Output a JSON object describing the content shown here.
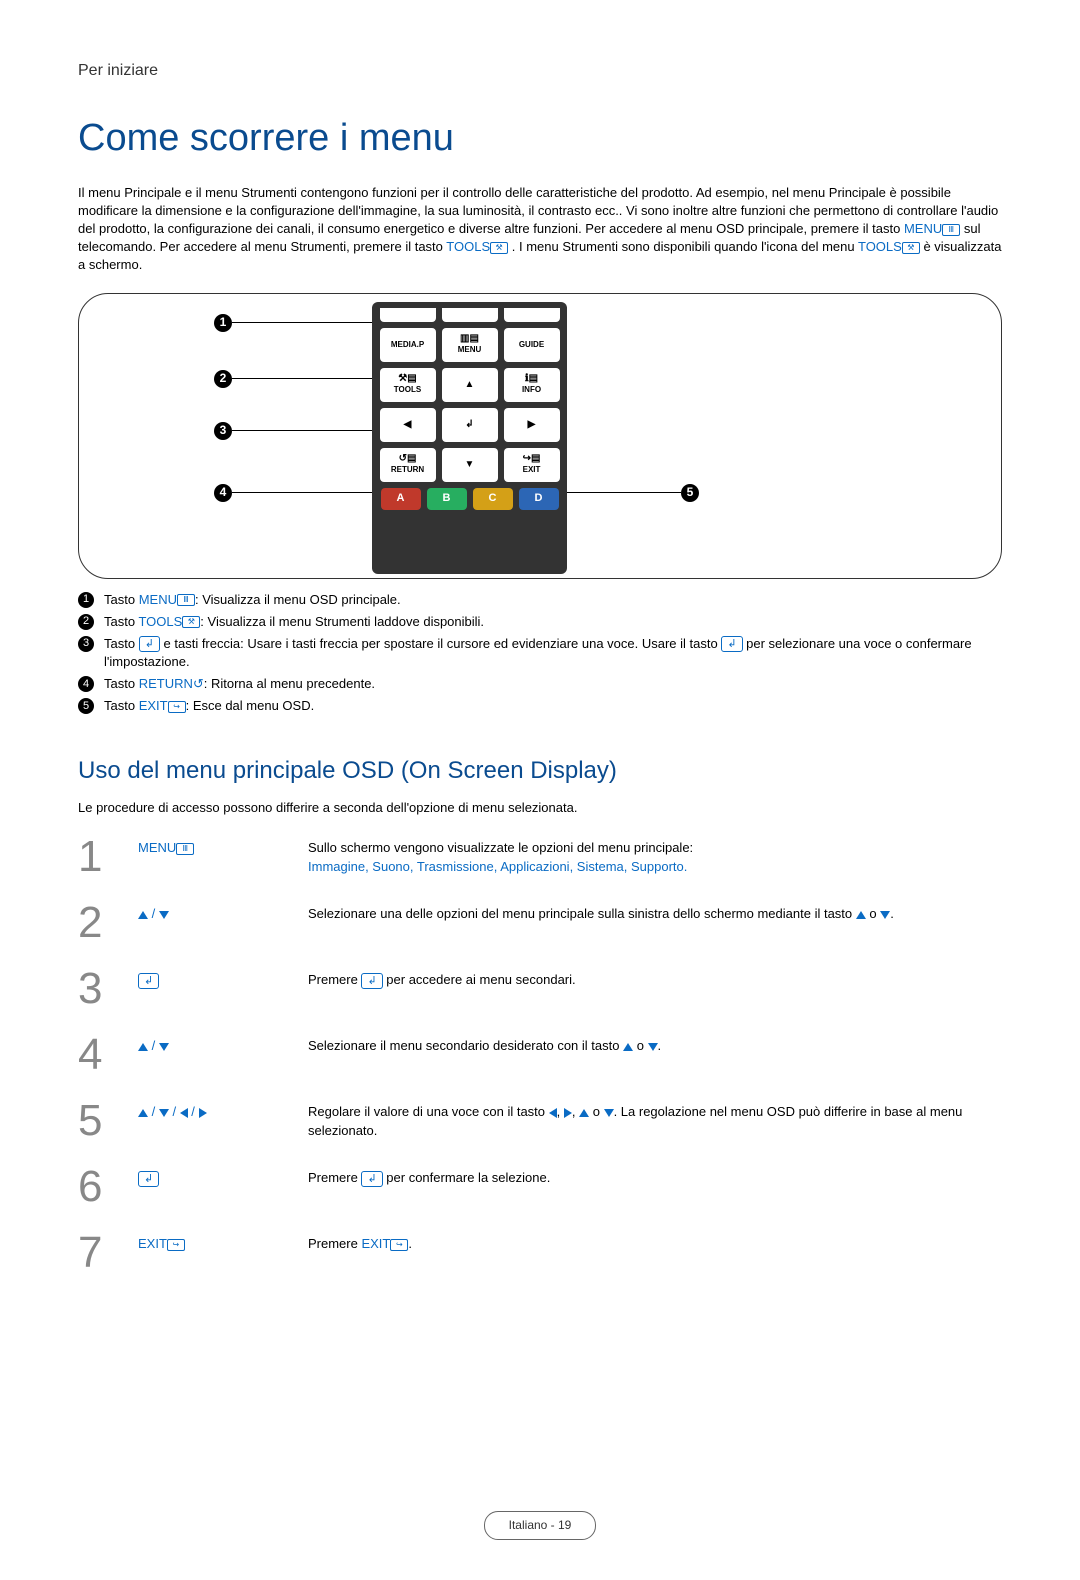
{
  "section_label": "Per iniziare",
  "title": "Come scorrere i menu",
  "intro": {
    "p1a": "Il menu Principale e il menu Strumenti contengono funzioni per il controllo delle caratteristiche del prodotto. Ad esempio, nel menu Principale è possibile modificare la dimensione e la configurazione dell'immagine, la sua luminosità, il contrasto ecc.. Vi sono inoltre altre funzioni che permettono di controllare l'audio del prodotto, la configurazione dei canali, il consumo energetico e diverse altre funzioni. Per accedere al menu OSD principale, premere il tasto ",
    "menu": "MENU",
    "p1b": " sul telecomando. Per accedere al menu Strumenti, premere il tasto ",
    "tools": "TOOLS",
    "p1c": ". I menu Strumenti sono disponibili quando l'icona del menu ",
    "tools2": "TOOLS",
    "p1d": " è visualizzata a schermo."
  },
  "remote": {
    "mediap": "MEDIA.P",
    "menu": "MENU",
    "guide": "GUIDE",
    "tools": "TOOLS",
    "info": "INFO",
    "return": "RETURN",
    "exit": "EXIT",
    "a": "A",
    "b": "B",
    "c": "C",
    "d": "D"
  },
  "legend": [
    {
      "pre": "Tasto ",
      "key": "MENU",
      "post": ": Visualizza il menu OSD principale."
    },
    {
      "pre": "Tasto ",
      "key": "TOOLS",
      "post": ": Visualizza il menu Strumenti laddove disponibili."
    },
    {
      "pre": "Tasto ",
      "key": "",
      "mid": " e tasti freccia: Usare i tasti freccia per spostare il cursore ed evidenziare una voce. Usare il tasto ",
      "post": " per selezionare una voce o confermare l'impostazione."
    },
    {
      "pre": "Tasto ",
      "key": "RETURN",
      "post": ": Ritorna al menu precedente."
    },
    {
      "pre": "Tasto ",
      "key": "EXIT",
      "post": ": Esce dal menu OSD."
    }
  ],
  "h2": "Uso del menu principale OSD (On Screen Display)",
  "subtext": "Le procedure di accesso possono differire a seconda dell'opzione di menu selezionata.",
  "steps": [
    {
      "n": "1",
      "key": "MENU",
      "desc_a": "Sullo schermo vengono visualizzate le opzioni del menu principale:",
      "desc_accent": "Immagine, Suono, Trasmissione, Applicazioni, Sistema, Supporto.",
      "desc_b": ""
    },
    {
      "n": "2",
      "desc_a": "Selezionare una delle opzioni del menu principale sulla sinistra dello schermo mediante il tasto ",
      "desc_b": " o ",
      "desc_c": "."
    },
    {
      "n": "3",
      "desc_a": "Premere ",
      "desc_b": " per accedere ai menu secondari."
    },
    {
      "n": "4",
      "desc_a": "Selezionare il menu secondario desiderato con il tasto ",
      "desc_b": " o ",
      "desc_c": "."
    },
    {
      "n": "5",
      "desc_a": "Regolare il valore di una voce con il tasto ",
      "desc_b": ", ",
      "desc_c": ", ",
      "desc_d": " o ",
      "desc_e": ". La regolazione nel menu OSD può differire in base al menu selezionato."
    },
    {
      "n": "6",
      "desc_a": "Premere ",
      "desc_b": " per confermare la selezione."
    },
    {
      "n": "7",
      "key": "EXIT",
      "desc_a": "Premere ",
      "desc_key": "EXIT",
      "desc_b": "."
    }
  ],
  "footer": "Italiano - 19"
}
